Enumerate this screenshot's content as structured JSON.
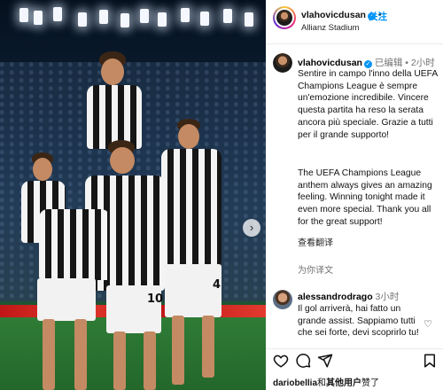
{
  "header": {
    "username": "vlahovicdusan",
    "separator": "•",
    "follow_label": "关注",
    "location": "Allianz Stadium",
    "more_icon": "more-horizontal-icon"
  },
  "caption": {
    "username": "vlahovicdusan",
    "edited_label": "已编辑",
    "separator": "•",
    "time": "2小时",
    "text_it": "Sentire in campo l'inno della UEFA Champions League è sempre un'emozione incredibile. Vincere questa partita ha reso la serata ancora più speciale. Grazie a tutti per il grande supporto!",
    "text_en": "The UEFA Champions League anthem always gives an amazing feeling. Winning tonight made it even more special. Thank you all for the great support!",
    "translate_label": "查看翻译",
    "reply_label": "为你译文"
  },
  "comment": {
    "username": "alessandrodrago",
    "time": "3小时",
    "text": "Il gol arriverà, hai fatto un grande assist. Sappiamo tutti che sei forte, devi scoprirlo tu!"
  },
  "actions": {
    "like_icon": "heart-icon",
    "comment_icon": "comment-icon",
    "share_icon": "send-icon",
    "save_icon": "bookmark-icon"
  },
  "likes": {
    "user": "dariobellia",
    "rest": "和",
    "others": "其他用户",
    "suffix": "赞了"
  },
  "photo": {
    "next_icon": "chevron-right-icon",
    "shirt_numbers": [
      "10",
      "4"
    ]
  },
  "colors": {
    "accent": "#0095f6",
    "verified": "#0095f6",
    "banner": "#c01616"
  }
}
